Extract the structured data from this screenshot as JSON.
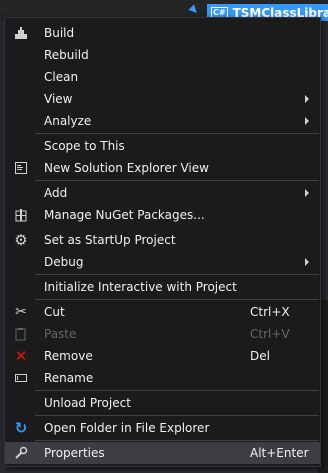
{
  "solution_explorer": {
    "project_badge": "C#",
    "project_name": "TSMClassLibrary"
  },
  "context_menu": {
    "items": [
      {
        "label": "Build",
        "icon": "build-icon"
      },
      {
        "label": "Rebuild"
      },
      {
        "label": "Clean"
      },
      {
        "label": "View",
        "submenu": true
      },
      {
        "label": "Analyze",
        "submenu": true
      },
      {
        "label": "Scope to This"
      },
      {
        "label": "New Solution Explorer View",
        "icon": "new-view-icon"
      },
      {
        "label": "Add",
        "submenu": true
      },
      {
        "label": "Manage NuGet Packages...",
        "icon": "nuget-icon"
      },
      {
        "label": "Set as StartUp Project",
        "icon": "gear-icon"
      },
      {
        "label": "Debug",
        "submenu": true
      },
      {
        "label": "Initialize Interactive with Project"
      },
      {
        "label": "Cut",
        "shortcut": "Ctrl+X",
        "icon": "scissors-icon"
      },
      {
        "label": "Paste",
        "shortcut": "Ctrl+V",
        "icon": "paste-icon",
        "disabled": true
      },
      {
        "label": "Remove",
        "shortcut": "Del",
        "icon": "remove-icon",
        "icon_color": "#e51400"
      },
      {
        "label": "Rename",
        "icon": "rename-icon"
      },
      {
        "label": "Unload Project"
      },
      {
        "label": "Open Folder in File Explorer",
        "icon": "refresh-arrow-icon",
        "icon_color": "#3399ff"
      },
      {
        "label": "Properties",
        "shortcut": "Alt+Enter",
        "icon": "wrench-icon",
        "highlighted": true
      }
    ]
  }
}
